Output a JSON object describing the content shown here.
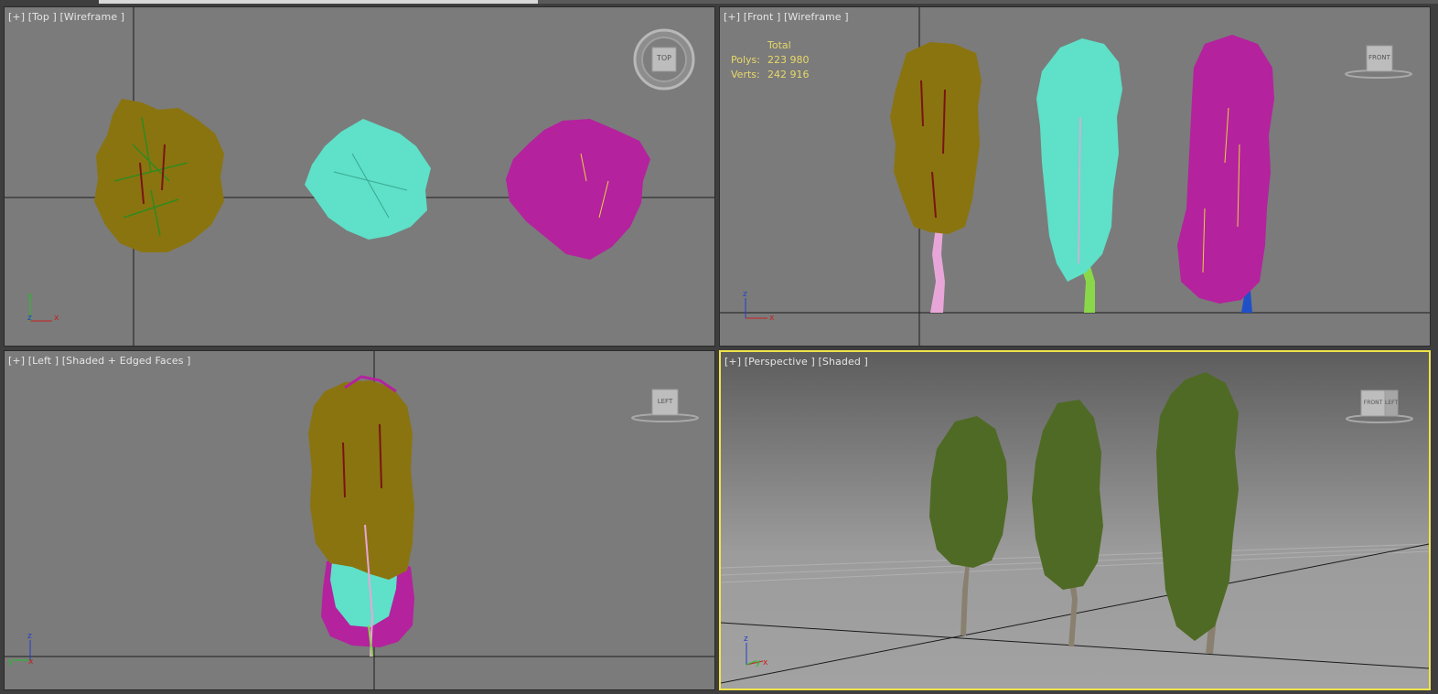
{
  "viewports": {
    "top": {
      "label": "[+] [Top ] [Wireframe ]",
      "viewcube": "TOP"
    },
    "front": {
      "label": "[+] [Front ] [Wireframe ]",
      "viewcube": "FRONT"
    },
    "left": {
      "label": "[+] [Left ] [Shaded + Edged Faces ]",
      "viewcube": "LEFT"
    },
    "perspective": {
      "label": "[+] [Perspective ] [Shaded ]",
      "viewcube_left": "FRONT",
      "viewcube_right": "LEFT"
    }
  },
  "stats": {
    "title": "Total",
    "polys_label": "Polys:",
    "polys_value": "223 980",
    "verts_label": "Verts:",
    "verts_value": "242 916"
  },
  "colors": {
    "viewport_bg": "#7b7b7b",
    "active_border": "#f2e34a",
    "tree_olive": "#8a7410",
    "tree_cyan": "#5fe0c8",
    "tree_magenta": "#b4229e",
    "stats_text": "#e8d86a"
  },
  "axes": {
    "x": "x",
    "y": "y",
    "z": "z"
  }
}
